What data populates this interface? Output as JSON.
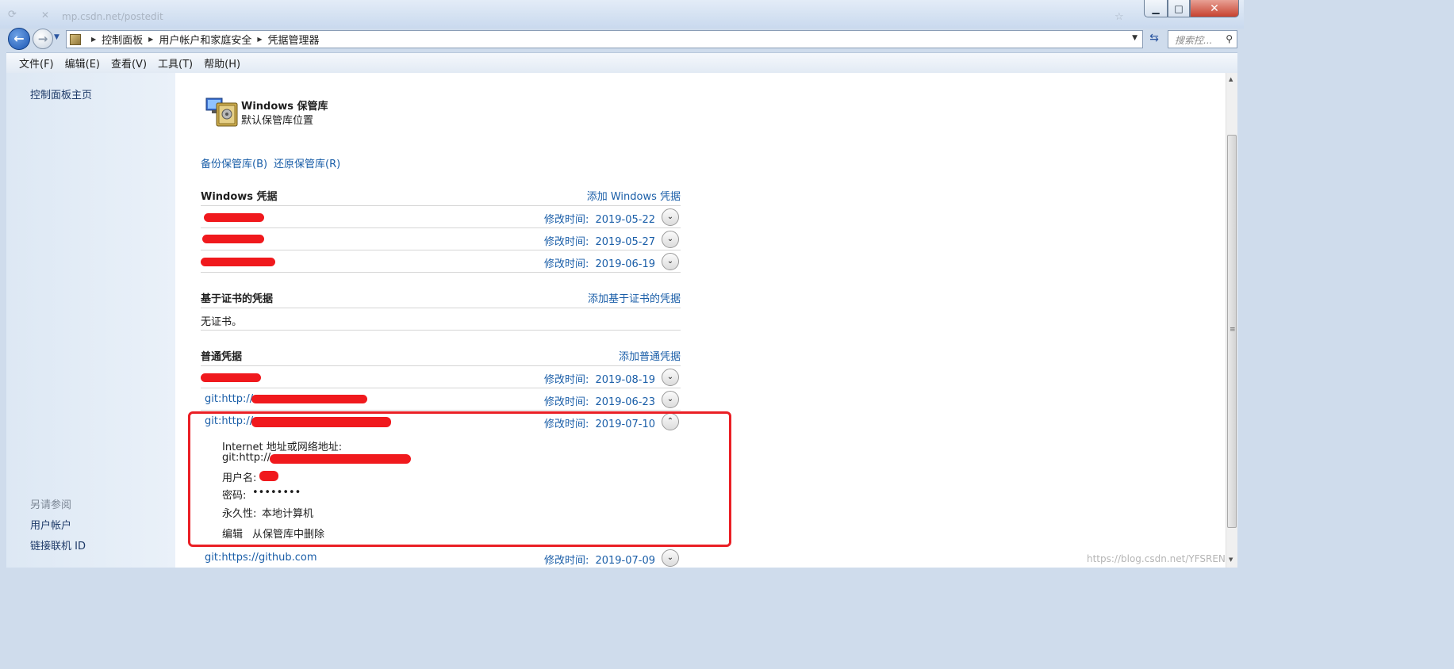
{
  "window": {
    "title_ghost": "mp.csdn.net/postedit",
    "min_label": "▭",
    "max_label": "▢",
    "close_label": "✕"
  },
  "address": {
    "crumbs": [
      "控制面板",
      "用户帐户和家庭安全",
      "凭据管理器"
    ],
    "search_placeholder": "搜索控..."
  },
  "menu": [
    "文件(F)",
    "编辑(E)",
    "查看(V)",
    "工具(T)",
    "帮助(H)"
  ],
  "sidebar": {
    "home": "控制面板主页",
    "see_also": "另请参阅",
    "links": [
      "用户帐户",
      "链接联机 ID"
    ]
  },
  "vault": {
    "title": "Windows 保管库",
    "subtitle": "默认保管库位置",
    "backup": "备份保管库(B)",
    "restore": "还原保管库(R)"
  },
  "modified_label": "修改时间:",
  "windows_creds": {
    "title": "Windows 凭据",
    "add": "添加 Windows 凭据",
    "rows": [
      {
        "date": "2019-05-22"
      },
      {
        "date": "2019-05-27"
      },
      {
        "date": "2019-06-19"
      }
    ]
  },
  "cert_creds": {
    "title": "基于证书的凭据",
    "add": "添加基于证书的凭据",
    "empty": "无证书。"
  },
  "generic_creds": {
    "title": "普通凭据",
    "add": "添加普通凭据",
    "rows": [
      {
        "name": "",
        "date": "2019-08-19"
      },
      {
        "name": "git:http://",
        "date": "2019-06-23"
      },
      {
        "name": "git:http://",
        "date": "2019-07-10"
      }
    ],
    "expanded": {
      "address_label": "Internet 地址或网络地址:",
      "address_value": "git:http://",
      "username_label": "用户名:",
      "password_label": "密码:",
      "password_value": "••••••••",
      "persistence_label": "永久性:",
      "persistence_value": "本地计算机",
      "edit": "编辑",
      "remove": "从保管库中删除"
    },
    "last_row": {
      "name": "git:https://github.com",
      "date": "2019-07-09"
    }
  },
  "watermark": "https://blog.csdn.net/YFSREN",
  "colors": {
    "link": "#1a5ea8",
    "redaction": "#f0191d",
    "highlight_box": "#ea1f25"
  }
}
